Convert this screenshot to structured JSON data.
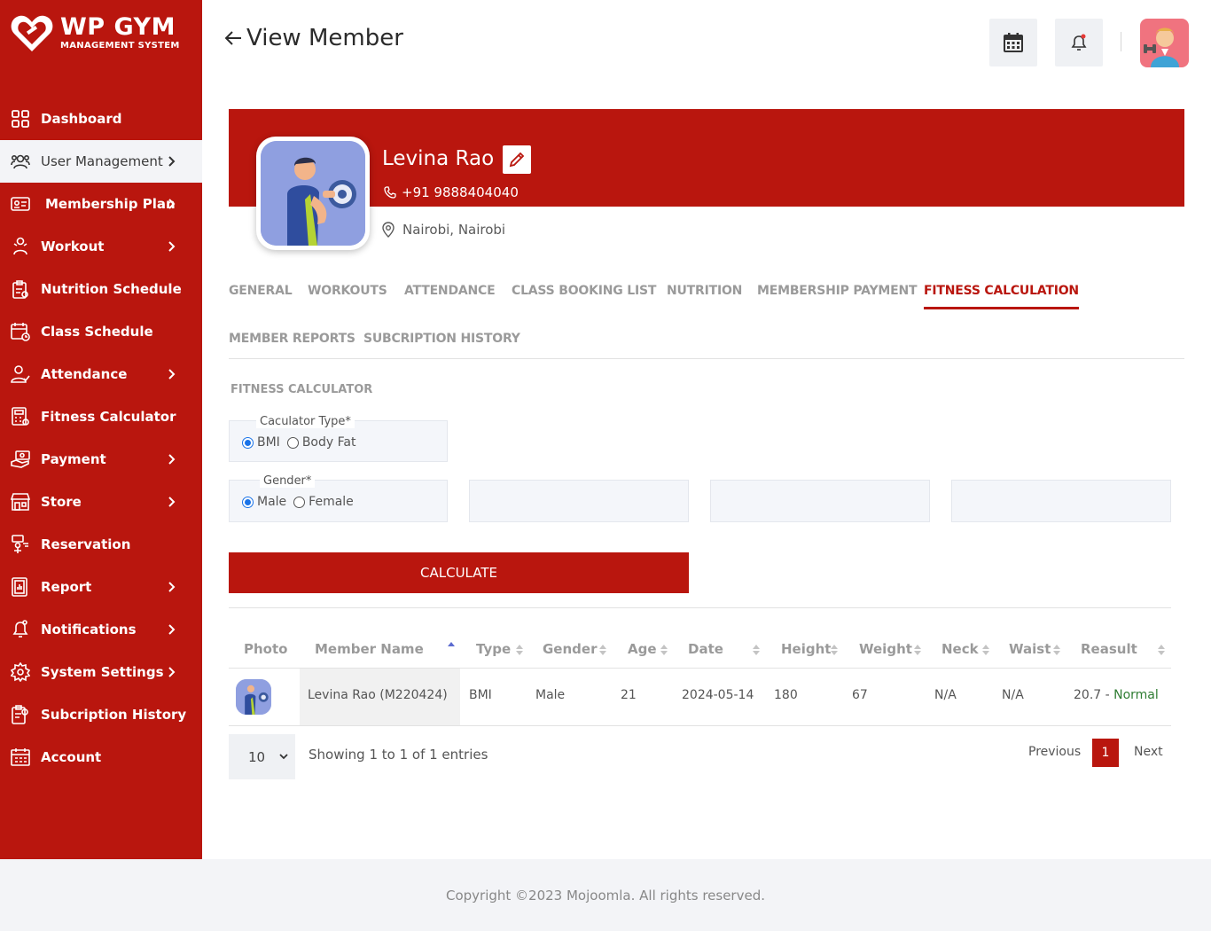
{
  "brand": {
    "title": "WP GYM",
    "subtitle": "MANAGEMENT SYSTEM",
    "color": "#b9160e"
  },
  "sidebar": {
    "items": [
      {
        "label": "Dashboard",
        "icon": "dashboard-icon",
        "has_chevron": false
      },
      {
        "label": "User Management",
        "icon": "users-icon",
        "has_chevron": true,
        "active": true
      },
      {
        "label": "Membership Plan",
        "icon": "membership-card-icon",
        "has_chevron": true
      },
      {
        "label": "Workout",
        "icon": "workout-icon",
        "has_chevron": true
      },
      {
        "label": "Nutrition Schedule",
        "icon": "nutrition-icon",
        "has_chevron": false
      },
      {
        "label": "Class Schedule",
        "icon": "calendar-icon",
        "has_chevron": false
      },
      {
        "label": "Attendance",
        "icon": "attendance-icon",
        "has_chevron": true
      },
      {
        "label": "Fitness Calculator",
        "icon": "calculator-icon",
        "has_chevron": false
      },
      {
        "label": "Payment",
        "icon": "payment-icon",
        "has_chevron": true
      },
      {
        "label": "Store",
        "icon": "store-icon",
        "has_chevron": true
      },
      {
        "label": "Reservation",
        "icon": "reservation-icon",
        "has_chevron": false
      },
      {
        "label": "Report",
        "icon": "report-icon",
        "has_chevron": true
      },
      {
        "label": "Notifications",
        "icon": "bell-icon",
        "has_chevron": true
      },
      {
        "label": "System Settings",
        "icon": "gear-icon",
        "has_chevron": true
      },
      {
        "label": "Subcription History",
        "icon": "history-icon",
        "has_chevron": false
      },
      {
        "label": "Account",
        "icon": "account-icon",
        "has_chevron": false
      }
    ]
  },
  "header": {
    "title": "View Member"
  },
  "profile": {
    "name": "Levina Rao",
    "phone": "+91  9888404040",
    "location": "Nairobi, Nairobi"
  },
  "tabs": [
    {
      "label": "GENERAL"
    },
    {
      "label": "WORKOUTS"
    },
    {
      "label": "ATTENDANCE"
    },
    {
      "label": "CLASS BOOKING LIST"
    },
    {
      "label": "NUTRITION"
    },
    {
      "label": "MEMBERSHIP PAYMENT"
    },
    {
      "label": "FITNESS CALCULATION",
      "active": true
    },
    {
      "label": "MEMBER REPORTS"
    },
    {
      "label": "SUBCRIPTION HISTORY"
    }
  ],
  "calculator": {
    "section_title": "FITNESS CALCULATOR",
    "type_legend": "Caculator Type*",
    "type_options": [
      "BMI",
      "Body Fat"
    ],
    "type_selected": "BMI",
    "gender_legend": "Gender*",
    "gender_options": [
      "Male",
      "Female"
    ],
    "gender_selected": "Male",
    "button_label": "CALCULATE"
  },
  "table": {
    "headers": [
      "Photo",
      "Member Name",
      "Type",
      "Gender",
      "Age",
      "Date",
      "Height",
      "Weight",
      "Neck",
      "Waist",
      "Reasult"
    ],
    "rows": [
      {
        "member_name": "Levina Rao (M220424)",
        "type": "BMI",
        "gender": "Male",
        "age": "21",
        "date": "2024-05-14",
        "height": "180",
        "weight": "67",
        "neck": "N/A",
        "waist": "N/A",
        "result_value": "20.7 - ",
        "result_status": "Normal"
      }
    ]
  },
  "pagination": {
    "page_size": "10",
    "showing": "Showing 1 to 1 of 1 entries",
    "previous": "Previous",
    "current_page": "1",
    "next": "Next"
  },
  "footer": {
    "copyright": "Copyright ©2023 Mojoomla. All rights reserved."
  }
}
